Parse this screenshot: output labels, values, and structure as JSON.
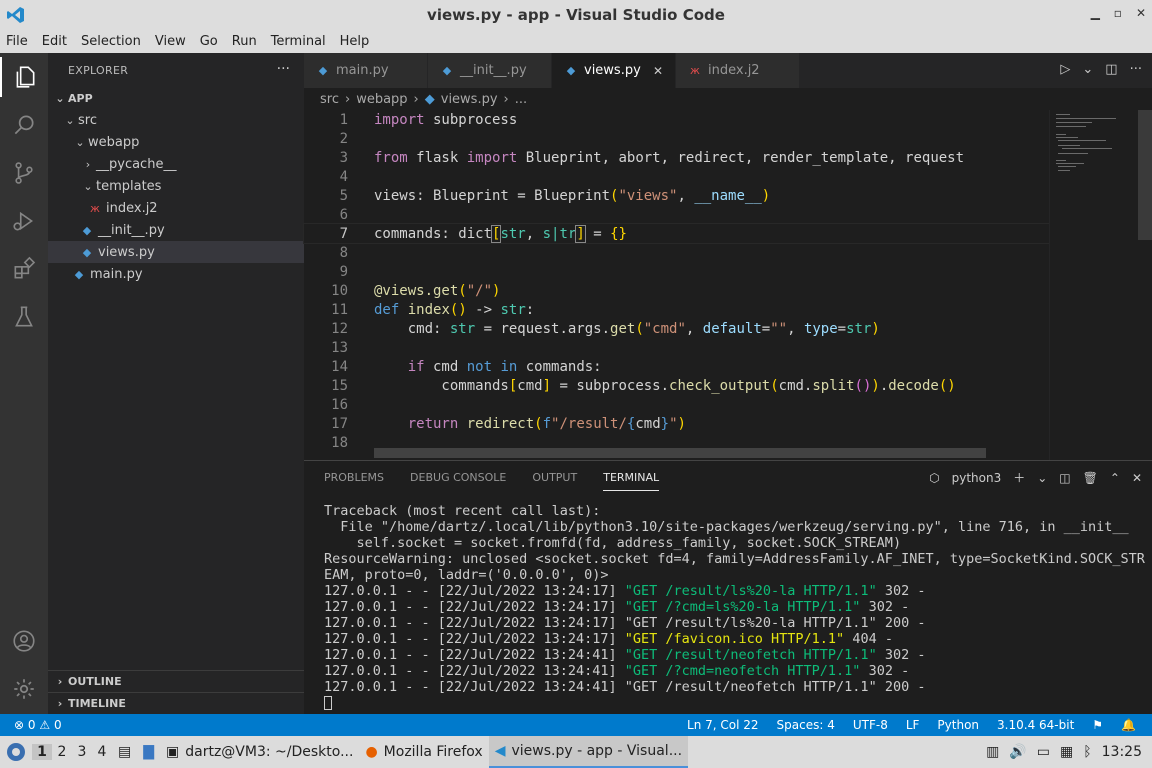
{
  "window": {
    "title": "views.py - app - Visual Studio Code"
  },
  "menu": [
    "File",
    "Edit",
    "Selection",
    "View",
    "Go",
    "Run",
    "Terminal",
    "Help"
  ],
  "explorer": {
    "header": "EXPLORER",
    "root": "APP",
    "items": [
      {
        "label": "src",
        "type": "folder"
      },
      {
        "label": "webapp",
        "type": "folder"
      },
      {
        "label": "__pycache__",
        "type": "folder"
      },
      {
        "label": "templates",
        "type": "folder"
      },
      {
        "label": "index.j2",
        "type": "j2"
      },
      {
        "label": "__init__.py",
        "type": "py"
      },
      {
        "label": "views.py",
        "type": "py"
      },
      {
        "label": "main.py",
        "type": "py"
      }
    ],
    "outline": "OUTLINE",
    "timeline": "TIMELINE"
  },
  "tabs": [
    {
      "label": "main.py"
    },
    {
      "label": "__init__.py"
    },
    {
      "label": "views.py"
    },
    {
      "label": "index.j2"
    }
  ],
  "breadcrumb": [
    "src",
    "webapp",
    "views.py",
    "..."
  ],
  "code": {
    "line_numbers": [
      "1",
      "2",
      "3",
      "4",
      "5",
      "6",
      "7",
      "8",
      "9",
      "10",
      "11",
      "12",
      "13",
      "14",
      "15",
      "16",
      "17",
      "18"
    ]
  },
  "panel": {
    "tabs": [
      "PROBLEMS",
      "DEBUG CONSOLE",
      "OUTPUT",
      "TERMINAL"
    ],
    "shell": "python3",
    "terminal_lines": [
      "Traceback (most recent call last):",
      "  File \"/home/dartz/.local/lib/python3.10/site-packages/werkzeug/serving.py\", line 716, in __init__",
      "    self.socket = socket.fromfd(fd, address_family, socket.SOCK_STREAM)",
      "ResourceWarning: unclosed <socket.socket fd=4, family=AddressFamily.AF_INET, type=SocketKind.SOCK_STR",
      "EAM, proto=0, laddr=('0.0.0.0', 0)>"
    ],
    "log_prefix": "127.0.0.1 - - ",
    "logs": [
      {
        "time": "[22/Jul/2022 13:24:17] ",
        "req": "\"GET /result/ls%20-la HTTP/1.1\"",
        "status": " 302 -",
        "color": "green"
      },
      {
        "time": "[22/Jul/2022 13:24:17] ",
        "req": "\"GET /?cmd=ls%20-la HTTP/1.1\"",
        "status": " 302 -",
        "color": "green"
      },
      {
        "time": "[22/Jul/2022 13:24:17] ",
        "req": "\"GET /result/ls%20-la HTTP/1.1\"",
        "status": " 200 -",
        "color": "none"
      },
      {
        "time": "[22/Jul/2022 13:24:17] ",
        "req": "\"GET /favicon.ico HTTP/1.1\"",
        "status": " 404 -",
        "color": "yellow"
      },
      {
        "time": "[22/Jul/2022 13:24:41] ",
        "req": "\"GET /result/neofetch HTTP/1.1\"",
        "status": " 302 -",
        "color": "green"
      },
      {
        "time": "[22/Jul/2022 13:24:41] ",
        "req": "\"GET /?cmd=neofetch HTTP/1.1\"",
        "status": " 302 -",
        "color": "green"
      },
      {
        "time": "[22/Jul/2022 13:24:41] ",
        "req": "\"GET /result/neofetch HTTP/1.1\"",
        "status": " 200 -",
        "color": "none"
      }
    ]
  },
  "status": {
    "errors": "0",
    "warnings": "0",
    "position": "Ln 7, Col 22",
    "spaces": "Spaces: 4",
    "encoding": "UTF-8",
    "eol": "LF",
    "language": "Python",
    "interpreter": "3.10.4 64-bit"
  },
  "taskbar": {
    "workspaces": [
      "1",
      "2",
      "3",
      "4"
    ],
    "terminal": "dartz@VM3: ~/Deskto...",
    "firefox": "Mozilla Firefox",
    "vscode": "views.py - app - Visual...",
    "clock": "13:25"
  },
  "colors": {
    "statusbar": "#007acc",
    "accent": "#569cd6"
  }
}
